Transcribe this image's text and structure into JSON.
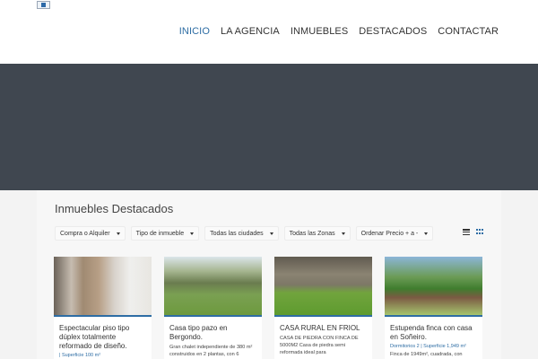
{
  "nav": {
    "items": [
      {
        "label": "INICIO",
        "active": true
      },
      {
        "label": "LA AGENCIA",
        "active": false
      },
      {
        "label": "INMUEBLES",
        "active": false
      },
      {
        "label": "DESTACADOS",
        "active": false
      },
      {
        "label": "CONTACTAR",
        "active": false
      }
    ]
  },
  "section": {
    "title": "Inmuebles Destacados"
  },
  "filters": [
    {
      "label": "Compra o Alquiler"
    },
    {
      "label": "Tipo de inmueble"
    },
    {
      "label": "Todas las ciudades"
    },
    {
      "label": "Todas las Zonas"
    },
    {
      "label": "Ordenar Precio + a -"
    }
  ],
  "view_icons": [
    "list-view-icon",
    "grid-view-icon"
  ],
  "colors": {
    "accent": "#2e6da4",
    "hero": "#404750"
  },
  "listings": [
    {
      "title": "Espectacular piso tipo dúplex totalmente reformado de diseño.",
      "desc": "",
      "meta": "| Superficie 100 m²"
    },
    {
      "title": "Casa tipo pazo en Bergondo.",
      "desc": "Gran chalet independiente de 380 m² construidos en 2 plantas, con 6",
      "meta": ""
    },
    {
      "title": "CASA RURAL EN FRIOL",
      "desc": "CASA DE PIEDRA CON FINCA DE 5000M2 Casa de piedra semi reformada ideal para",
      "meta": ""
    },
    {
      "title": "Estupenda finca con casa en Soñeiro.",
      "desc": "Finca de 1949m², cuadrada, con",
      "meta": "Dormitorios 2 | Superficie 1,949 m²"
    }
  ]
}
